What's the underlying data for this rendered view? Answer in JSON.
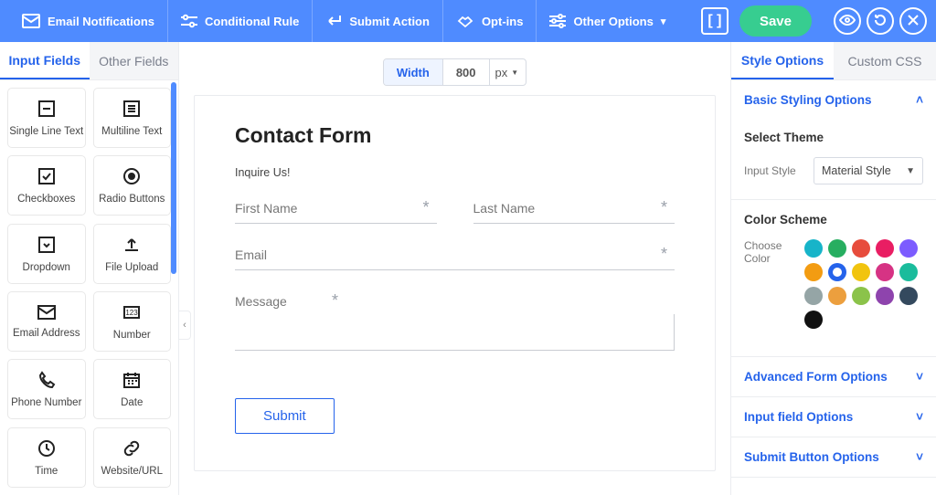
{
  "topbar": {
    "items": [
      {
        "label": "Email Notifications"
      },
      {
        "label": "Conditional Rule"
      },
      {
        "label": "Submit Action"
      },
      {
        "label": "Opt-ins"
      },
      {
        "label": "Other Options"
      }
    ],
    "bracket": "[ ]",
    "save": "Save"
  },
  "left_tabs": {
    "active": "Input Fields",
    "inactive": "Other Fields"
  },
  "field_tiles": [
    {
      "label": "Single Line Text",
      "icon": "minus-box"
    },
    {
      "label": "Multiline Text",
      "icon": "lines-box"
    },
    {
      "label": "Checkboxes",
      "icon": "check-box"
    },
    {
      "label": "Radio Buttons",
      "icon": "radio"
    },
    {
      "label": "Dropdown",
      "icon": "dropdown-box"
    },
    {
      "label": "File Upload",
      "icon": "upload"
    },
    {
      "label": "Email Address",
      "icon": "mail"
    },
    {
      "label": "Number",
      "icon": "num"
    },
    {
      "label": "Phone Number",
      "icon": "phone"
    },
    {
      "label": "Date",
      "icon": "calendar"
    },
    {
      "label": "Time",
      "icon": "clock"
    },
    {
      "label": "Website/URL",
      "icon": "link"
    }
  ],
  "width_bar": {
    "label": "Width",
    "value": "800",
    "unit": "px"
  },
  "form": {
    "title": "Contact Form",
    "subtitle": "Inquire Us!",
    "first_name": "First Name",
    "last_name": "Last Name",
    "email": "Email",
    "message": "Message",
    "submit": "Submit"
  },
  "right_tabs": {
    "active": "Style Options",
    "inactive": "Custom CSS"
  },
  "style": {
    "basic_heading": "Basic Styling Options",
    "select_theme": "Select Theme",
    "input_style_label": "Input Style",
    "input_style_value": "Material Style",
    "color_scheme": "Color Scheme",
    "choose_color": "Choose Color",
    "colors": [
      "#17b4c9",
      "#27ae60",
      "#e74c3c",
      "#e91e63",
      "#7c5cff",
      "#f39c12",
      "#2563eb",
      "#f1c40f",
      "#d63384",
      "#1abc9c",
      "#95a5a6",
      "#ec9f3e",
      "#8bc34a",
      "#8e44ad",
      "#34495e",
      "#111"
    ],
    "selected_color_index": 6,
    "advanced": "Advanced Form Options",
    "input_opts": "Input field Options",
    "submit_opts": "Submit Button Options"
  }
}
